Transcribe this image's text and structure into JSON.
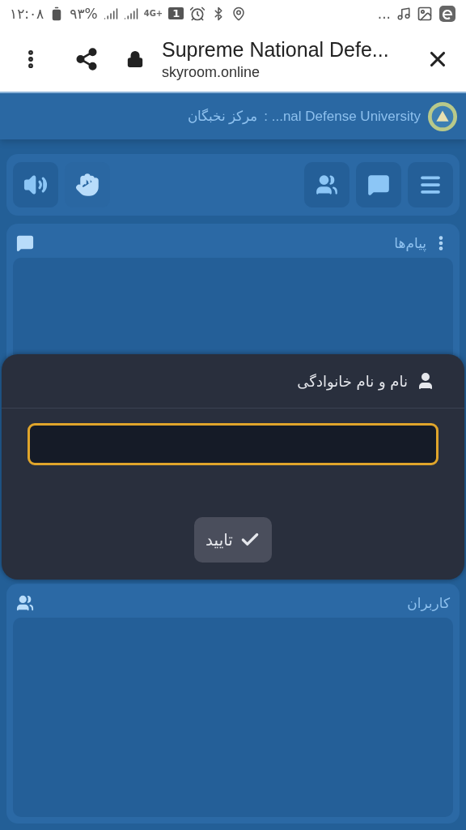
{
  "status_bar": {
    "time": "۱۲:۰۸",
    "battery": "۹۳%",
    "network": "4G+",
    "sim": "1",
    "overflow": "..."
  },
  "browser": {
    "title": "Supreme National Defe...",
    "url": "skyroom.online"
  },
  "header": {
    "name_persian": "مرکز نخبگان",
    "name_english": ": ...nal Defense University"
  },
  "toolbar": {
    "left": [
      {
        "kind": "speaker"
      },
      {
        "kind": "hand"
      }
    ],
    "right": [
      {
        "kind": "users"
      },
      {
        "kind": "chat"
      },
      {
        "kind": "menu"
      }
    ]
  },
  "messages_panel": {
    "title": "پیام‌ها"
  },
  "users_panel": {
    "title": "کاربران"
  },
  "dialog": {
    "title": "نام و نام خانوادگی",
    "field_focused": true,
    "button": "تایید"
  }
}
